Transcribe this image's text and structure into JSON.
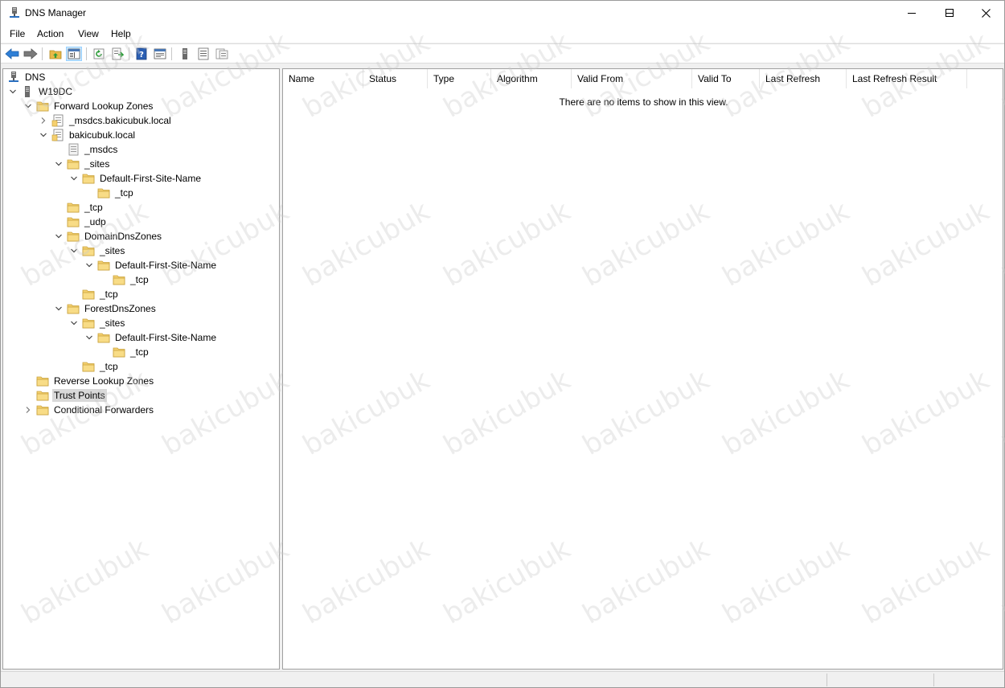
{
  "window": {
    "title": "DNS Manager",
    "icon": "dns-server-icon"
  },
  "menubar": {
    "items": [
      {
        "label": "File"
      },
      {
        "label": "Action"
      },
      {
        "label": "View"
      },
      {
        "label": "Help"
      }
    ]
  },
  "toolbar": {
    "buttons": [
      "back-arrow-icon",
      "forward-arrow-icon",
      "up-folder-icon",
      "show-hide-tree-icon",
      "refresh-icon",
      "export-list-icon",
      "help-icon",
      "properties-icon",
      "server-icon",
      "list-view-icon",
      "detail-view-icon"
    ]
  },
  "tree": {
    "nodes": [
      {
        "label": "DNS",
        "icon": "dns-root-icon"
      },
      {
        "label": "W19DC",
        "icon": "server-icon"
      },
      {
        "label": "Forward Lookup Zones",
        "icon": "folder-icon"
      },
      {
        "label": "_msdcs.bakicubuk.local",
        "icon": "zone-icon"
      },
      {
        "label": "bakicubuk.local",
        "icon": "zone-icon"
      },
      {
        "label": "_msdcs",
        "icon": "delegation-icon"
      },
      {
        "label": "_sites",
        "icon": "folder-icon"
      },
      {
        "label": "Default-First-Site-Name",
        "icon": "folder-icon"
      },
      {
        "label": "_tcp",
        "icon": "folder-icon"
      },
      {
        "label": "_tcp",
        "icon": "folder-icon"
      },
      {
        "label": "_udp",
        "icon": "folder-icon"
      },
      {
        "label": "DomainDnsZones",
        "icon": "folder-icon"
      },
      {
        "label": "_sites",
        "icon": "folder-icon"
      },
      {
        "label": "Default-First-Site-Name",
        "icon": "folder-icon"
      },
      {
        "label": "_tcp",
        "icon": "folder-icon"
      },
      {
        "label": "_tcp",
        "icon": "folder-icon"
      },
      {
        "label": "ForestDnsZones",
        "icon": "folder-icon"
      },
      {
        "label": "_sites",
        "icon": "folder-icon"
      },
      {
        "label": "Default-First-Site-Name",
        "icon": "folder-icon"
      },
      {
        "label": "_tcp",
        "icon": "folder-icon"
      },
      {
        "label": "_tcp",
        "icon": "folder-icon"
      },
      {
        "label": "Reverse Lookup Zones",
        "icon": "folder-icon"
      },
      {
        "label": "Trust Points",
        "icon": "folder-icon"
      },
      {
        "label": "Conditional Forwarders",
        "icon": "folder-icon"
      }
    ]
  },
  "list": {
    "columns": [
      "Name",
      "Status",
      "Type",
      "Algorithm",
      "Valid From",
      "Valid To",
      "Last Refresh",
      "Last Refresh Result"
    ],
    "empty_message": "There are no items to show in this view."
  },
  "watermark": {
    "text": "bakicubuk"
  },
  "colors": {
    "folder": "#f5d06f",
    "selection": "#d9d9d9",
    "toolbar_active": "#cce8ff"
  }
}
